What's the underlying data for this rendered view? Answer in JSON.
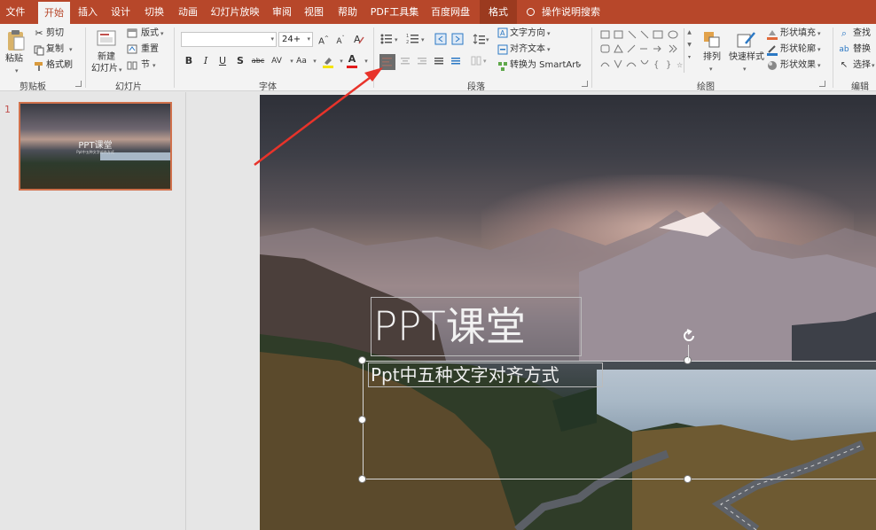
{
  "tabs": [
    {
      "label": "文件",
      "active": false
    },
    {
      "label": "开始",
      "active": true
    },
    {
      "label": "插入",
      "active": false
    },
    {
      "label": "设计",
      "active": false
    },
    {
      "label": "切换",
      "active": false
    },
    {
      "label": "动画",
      "active": false
    },
    {
      "label": "幻灯片放映",
      "active": false
    },
    {
      "label": "审阅",
      "active": false
    },
    {
      "label": "视图",
      "active": false
    },
    {
      "label": "帮助",
      "active": false
    },
    {
      "label": "PDF工具集",
      "active": false
    },
    {
      "label": "百度网盘",
      "active": false
    },
    {
      "label": "格式",
      "active": false,
      "contextual": true
    }
  ],
  "tell_me": "操作说明搜索",
  "clipboard": {
    "paste": "粘贴",
    "cut": "剪切",
    "copy": "复制",
    "format_painter": "格式刷",
    "group": "剪贴板"
  },
  "slides": {
    "new_slide_line1": "新建",
    "new_slide_line2": "幻灯片",
    "layout": "版式",
    "reset": "重置",
    "section": "节",
    "group": "幻灯片"
  },
  "font": {
    "name_value": "",
    "size_value": "24+",
    "bold": "B",
    "italic": "I",
    "underline": "U",
    "shadow": "S",
    "strike": "abc",
    "spacing": "AV",
    "case": "Aa",
    "font_color": "A",
    "group": "字体"
  },
  "paragraph": {
    "text_direction": "文字方向",
    "align_text": "对齐文本",
    "convert_smartart": "转换为 SmartArt",
    "group": "段落"
  },
  "drawing": {
    "arrange": "排列",
    "quick_styles": "快速样式",
    "shape_fill": "形状填充",
    "shape_outline": "形状轮廓",
    "shape_effects": "形状效果",
    "group": "绘图"
  },
  "editing": {
    "find": "查找",
    "replace": "替换",
    "select": "选择",
    "group": "编辑"
  },
  "thumbnail": {
    "number": "1",
    "title": "PPT课堂",
    "subtitle": "Ppt中五种文字对齐方式"
  },
  "slide": {
    "title": "PPT课堂",
    "subtitle": "Ppt中五种文字对齐方式"
  },
  "colors": {
    "accent": "#b7472a",
    "arrow": "#e8332a"
  }
}
